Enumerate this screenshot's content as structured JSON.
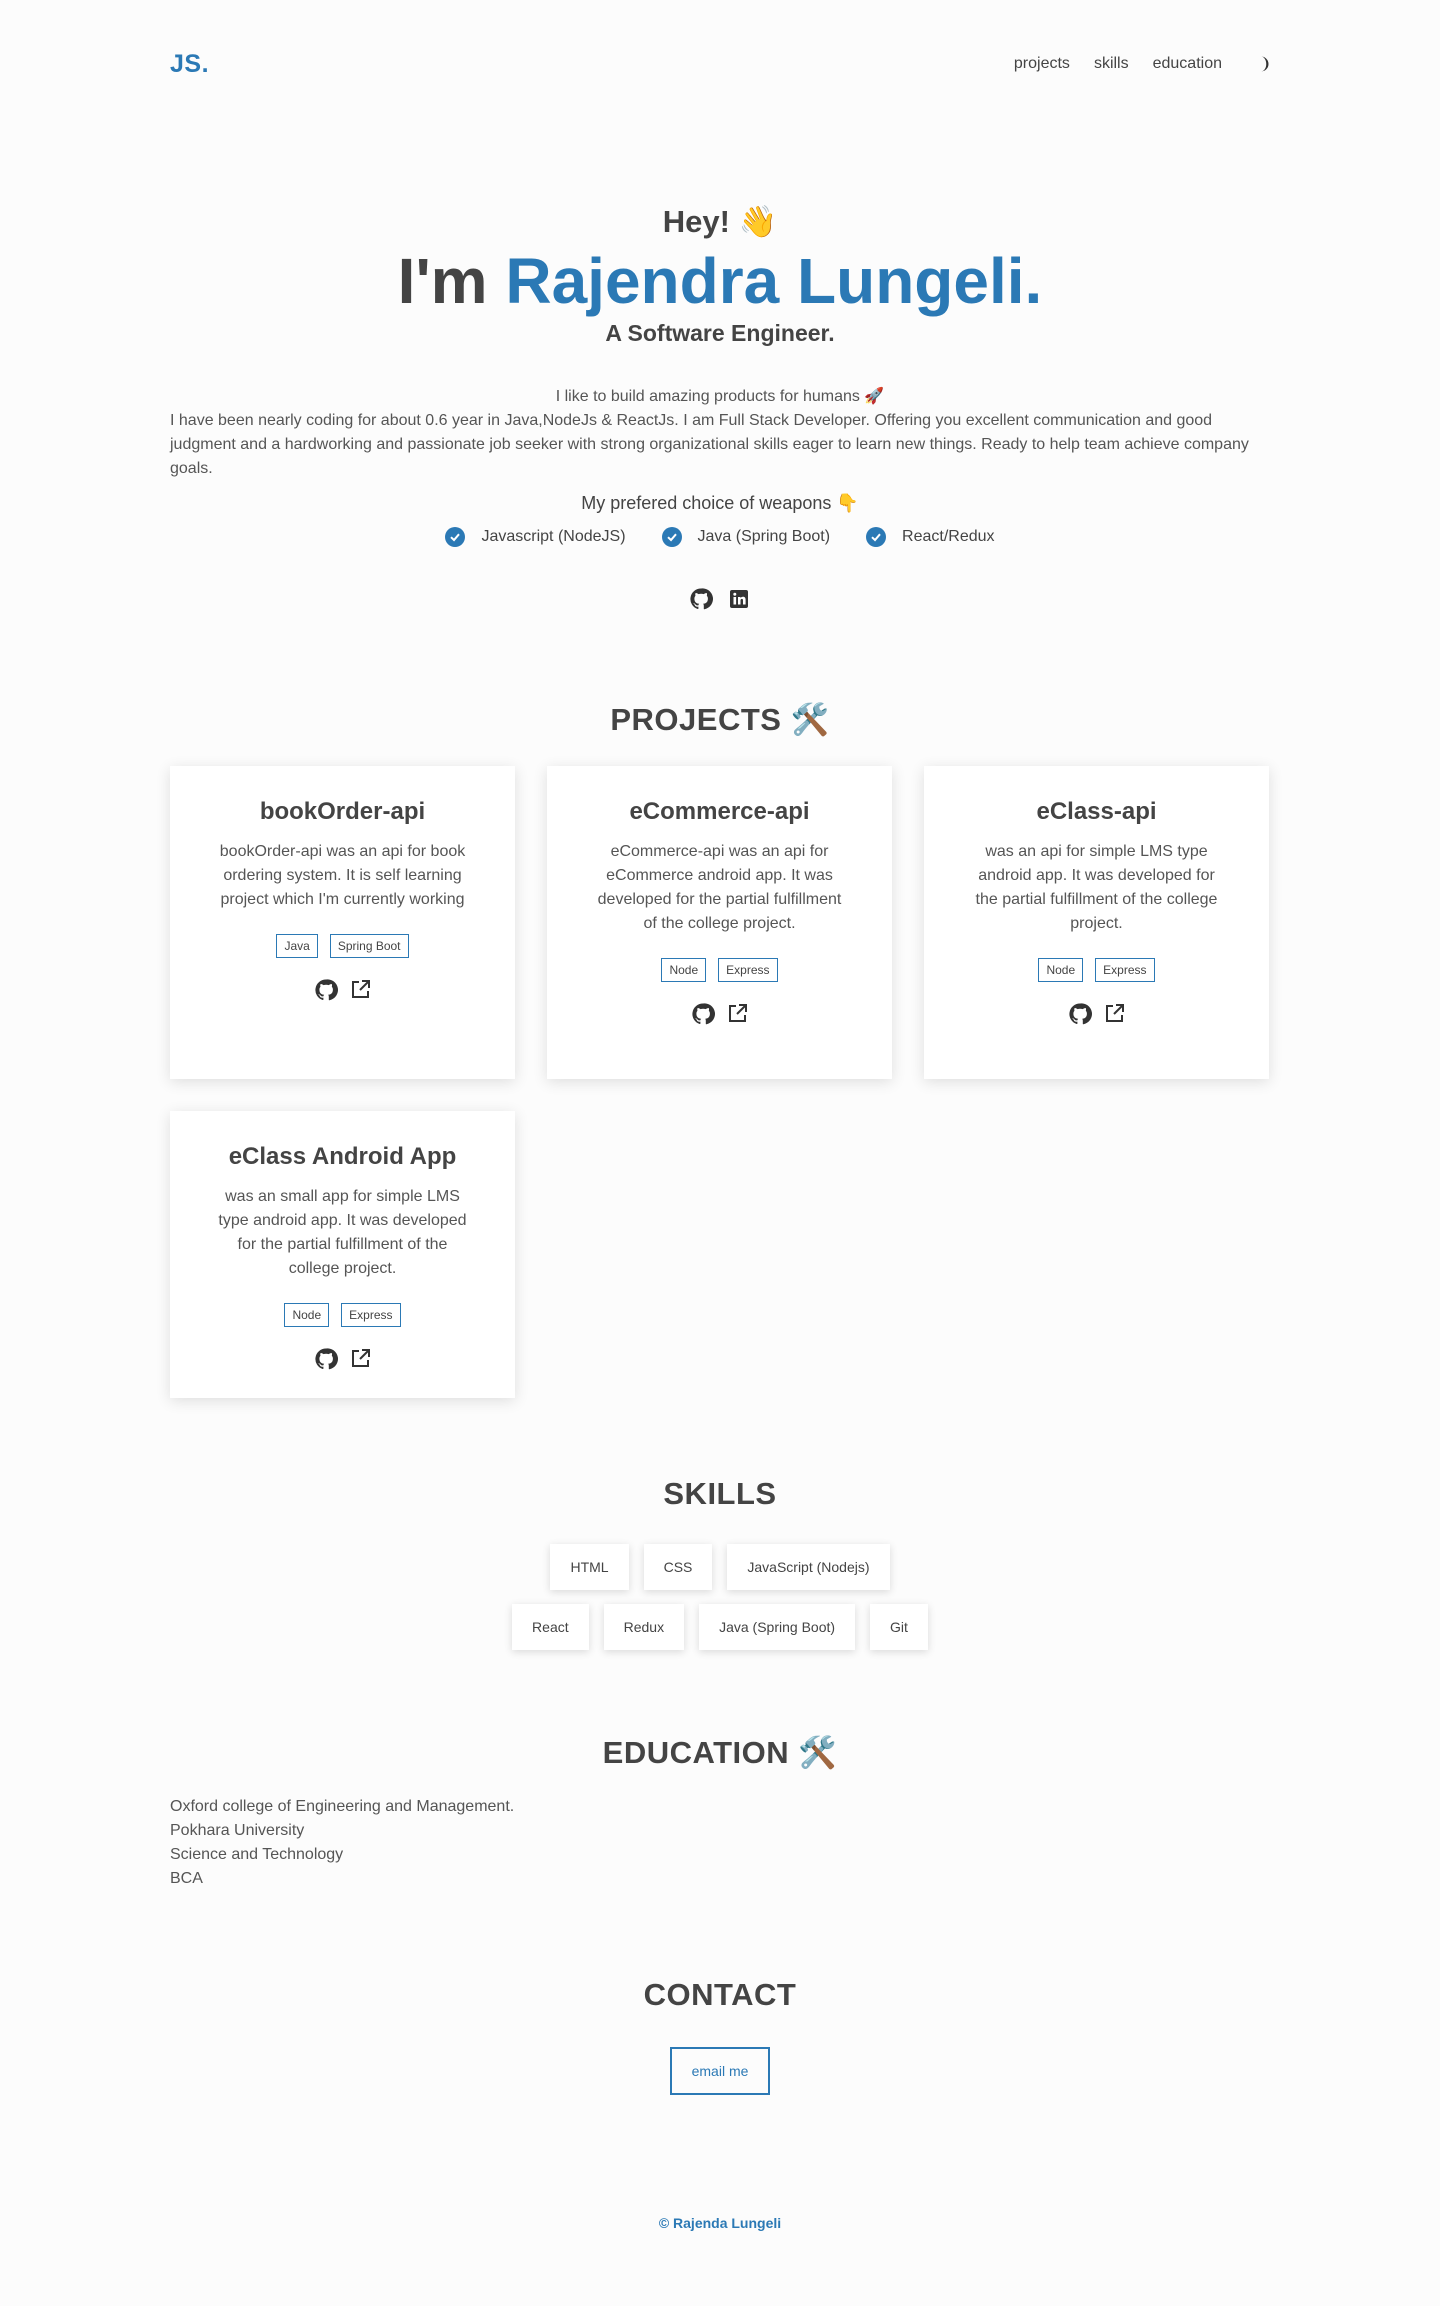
{
  "nav": {
    "logo": "JS.",
    "links": [
      "projects",
      "skills",
      "education"
    ],
    "theme_icon": "moon-icon"
  },
  "hero": {
    "greeting": "Hey! 👋",
    "im": "I'm",
    "name": "Rajendra Lungeli.",
    "role": "A Software Engineer.",
    "tagline": "I like to build amazing products for humans 🚀",
    "bio": "I have been nearly coding for about 0.6 year in Java,NodeJs & ReactJs. I am Full Stack Developer. Offering you excellent communication and good judgment and a hardworking and passionate job seeker with strong organizational skills eager to learn new things. Ready to help team achieve company goals.",
    "weapons_title": "My prefered choice of weapons 👇",
    "weapons": [
      "Javascript (NodeJS)",
      "Java (Spring Boot)",
      "React/Redux"
    ],
    "social_icons": [
      "github-icon",
      "linkedin-icon"
    ]
  },
  "projects": {
    "title": "PROJECTS 🛠️",
    "items": [
      {
        "title": "bookOrder-api",
        "desc": "bookOrder-api was an api for book ordering system. It is self learning project which I'm currently working",
        "tags": [
          "Java",
          "Spring Boot"
        ]
      },
      {
        "title": "eCommerce-api",
        "desc": "eCommerce-api was an api for eCommerce android app. It was developed for the partial fulfillment of the college project.",
        "tags": [
          "Node",
          "Express"
        ]
      },
      {
        "title": "eClass-api",
        "desc": "was an api for simple LMS type android app. It was developed for the partial fulfillment of the college project.",
        "tags": [
          "Node",
          "Express"
        ]
      },
      {
        "title": "eClass Android App",
        "desc": "was an small app for simple LMS type android app. It was developed for the partial fulfillment of the college project.",
        "tags": [
          "Node",
          "Express"
        ]
      }
    ]
  },
  "skills": {
    "title": "SKILLS",
    "row1": [
      "HTML",
      "CSS",
      "JavaScript (Nodejs)"
    ],
    "row2": [
      "React",
      "Redux",
      "Java (Spring Boot)",
      "Git"
    ]
  },
  "education": {
    "title": "EDUCATION 🛠️",
    "lines": [
      "Oxford college of Engineering and Management.",
      "Pokhara University",
      "Science and Technology",
      "BCA"
    ]
  },
  "contact": {
    "title": "CONTACT",
    "button": "email me"
  },
  "footer": {
    "text": "© Rajenda Lungeli"
  },
  "colors": {
    "accent": "#2b79b5",
    "text": "#444444",
    "background": "#fcfcfc"
  }
}
